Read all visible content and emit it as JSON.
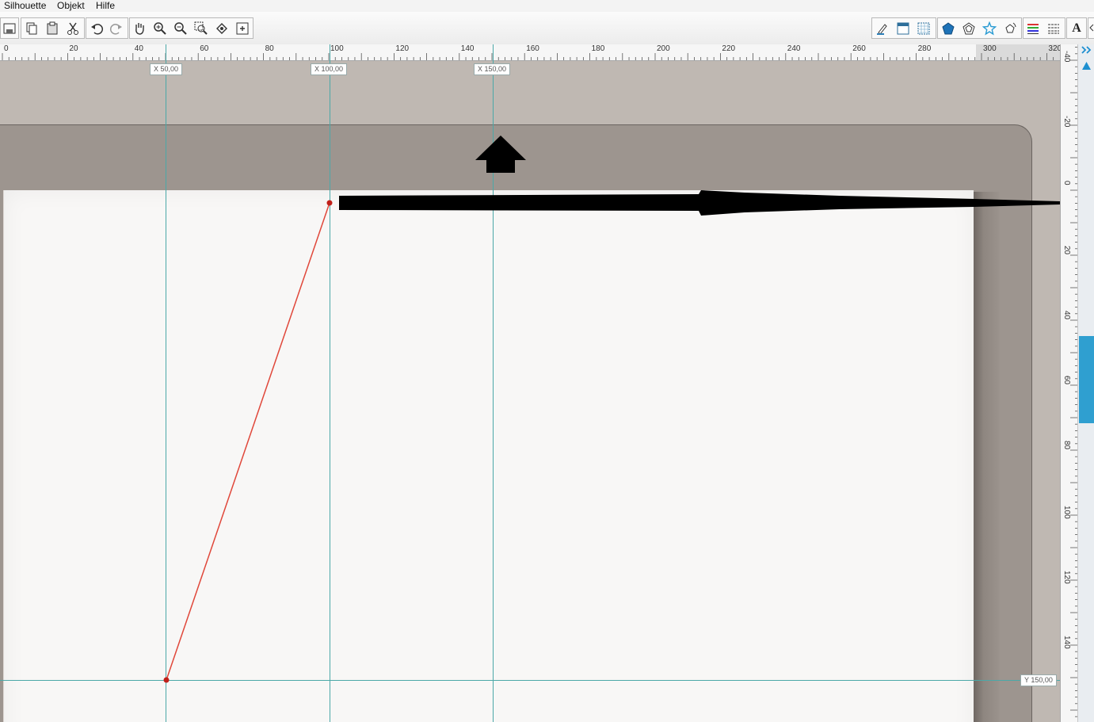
{
  "menu": {
    "items": [
      "Silhouette",
      "Objekt",
      "Hilfe"
    ]
  },
  "ruler_h": {
    "labels": [
      "0",
      "20",
      "40",
      "60",
      "80",
      "100",
      "120",
      "140",
      "160",
      "180",
      "200",
      "220",
      "240",
      "260",
      "280",
      "300",
      "320"
    ]
  },
  "ruler_v": {
    "labels": [
      "-40",
      "-20",
      "0",
      "20",
      "40",
      "60",
      "80",
      "100",
      "120",
      "140"
    ]
  },
  "guides": {
    "x1": "X  50,00",
    "x2": "X  100,00",
    "x3": "X  150,00",
    "y1": "Y  150,00"
  },
  "colors": {
    "guide": "#4ba8a8",
    "line": "#e0473a",
    "point": "#c0201a",
    "scroll_thumb": "#2f9fd0"
  },
  "toolbar": {
    "left_icons": [
      "save-icon",
      "copy-icon",
      "paste-icon",
      "cut-icon",
      "undo-icon",
      "redo-icon",
      "hand-pan-icon",
      "zoom-in-icon",
      "zoom-out-icon",
      "zoom-select-icon",
      "zoom-fit-icon",
      "zoom-page-icon"
    ],
    "right_icons": [
      "pen-fill-icon",
      "page-setup-icon",
      "grid-icon",
      "shape-filled-pentagon-icon",
      "shape-pentagon-icon",
      "shape-star-icon",
      "shape-rotate-icon",
      "line-color-icon",
      "line-style-icon",
      "text-icon"
    ],
    "text_tool_label": "A"
  }
}
